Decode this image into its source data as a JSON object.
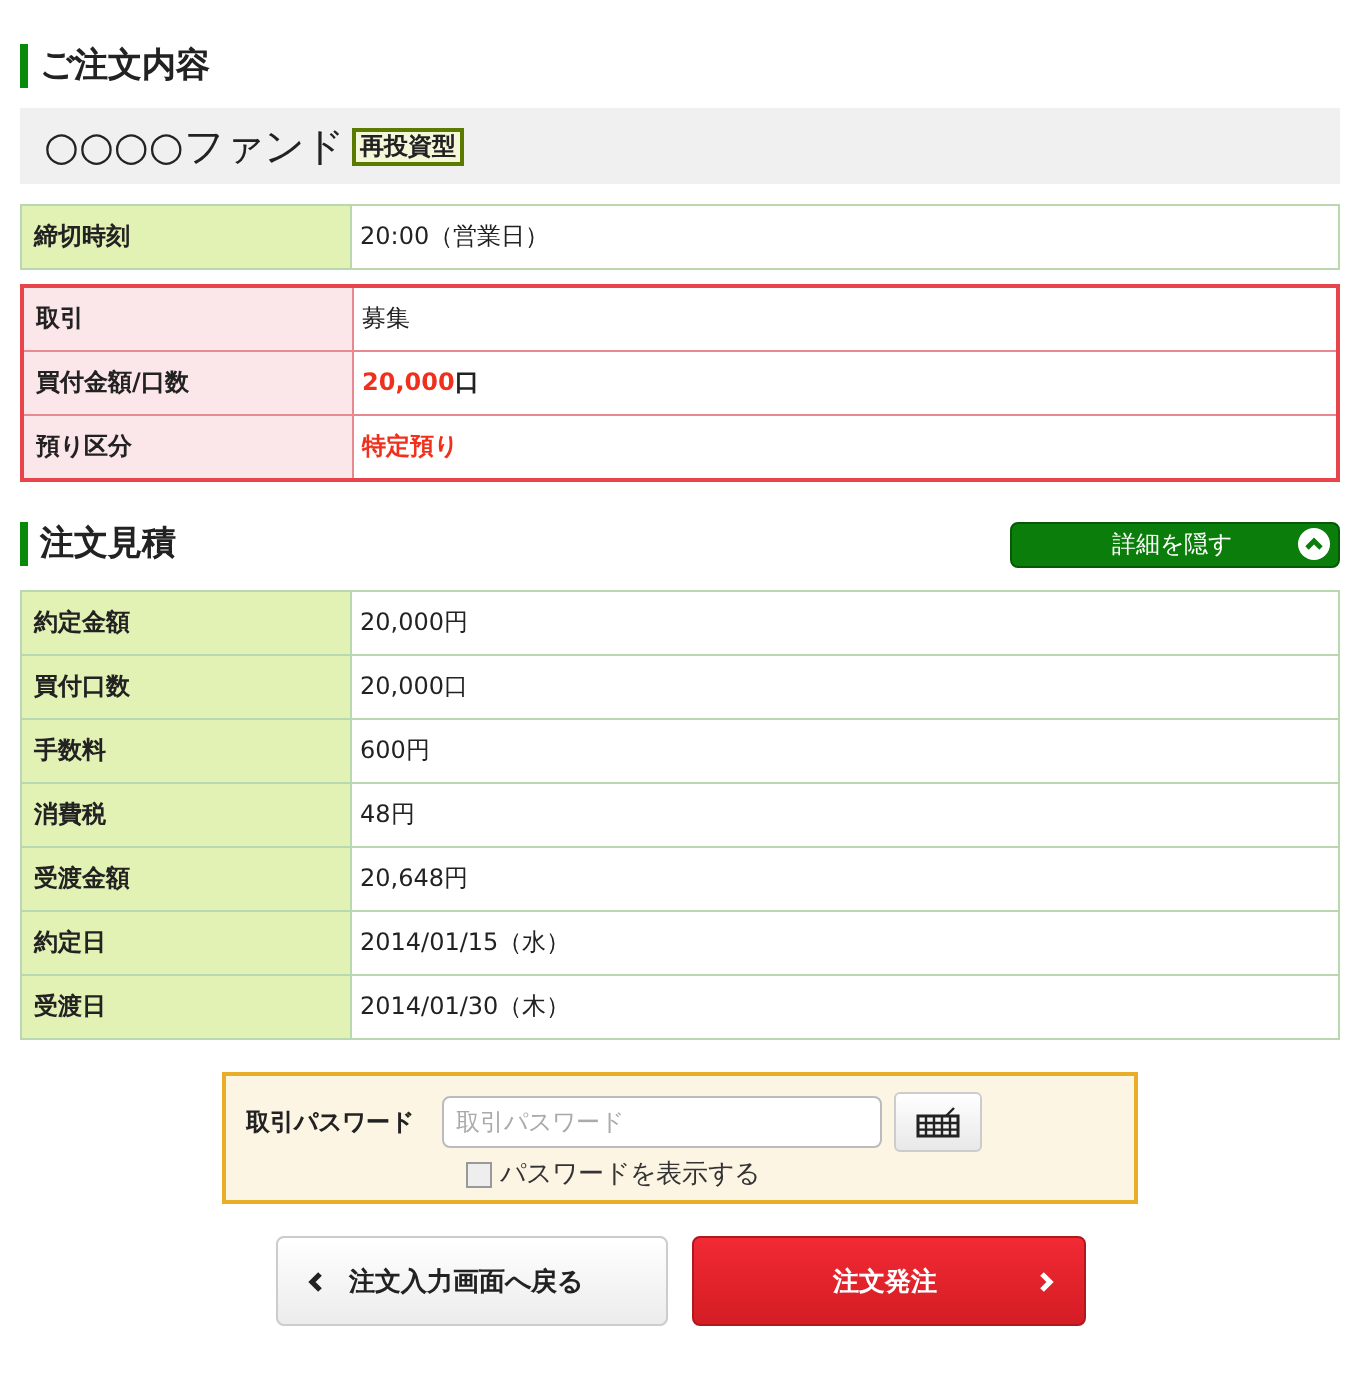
{
  "order": {
    "heading": "ご注文内容",
    "fund_name": "○○○○ファンド",
    "fund_tag": "再投資型",
    "tables": [
      {
        "kind": "normal",
        "rows": [
          {
            "label": "締切時刻",
            "value": "20:00（営業日）",
            "emphasis": false
          }
        ]
      },
      {
        "kind": "alert",
        "rows": [
          {
            "label": "取引",
            "value": "募集",
            "emphasis": false
          },
          {
            "label": "買付金額/口数",
            "value": "20,000",
            "suffix": "口",
            "emphasis": true
          },
          {
            "label": "預り区分",
            "value": "特定預り",
            "emphasis": true
          }
        ]
      }
    ]
  },
  "estimate": {
    "heading": "注文見積",
    "toggle": {
      "label": "詳細を隠す",
      "expanded": true
    },
    "rows": [
      {
        "label": "約定金額",
        "value": "20,000円"
      },
      {
        "label": "買付口数",
        "value": "20,000口"
      },
      {
        "label": "手数料",
        "value": "600円"
      },
      {
        "label": "消費税",
        "value": "48円"
      },
      {
        "label": "受渡金額",
        "value": "20,648円"
      },
      {
        "label": "約定日",
        "value": "2014/01/15（水）"
      },
      {
        "label": "受渡日",
        "value": "2014/01/30（木）"
      }
    ]
  },
  "password": {
    "label": "取引パスワード",
    "placeholder": "取引パスワード",
    "show_label": "パスワードを表示する",
    "checked": false
  },
  "buttons": [
    {
      "kind": "back",
      "label": "注文入力画面へ戻る"
    },
    {
      "kind": "submit",
      "label": "注文発注"
    }
  ]
}
